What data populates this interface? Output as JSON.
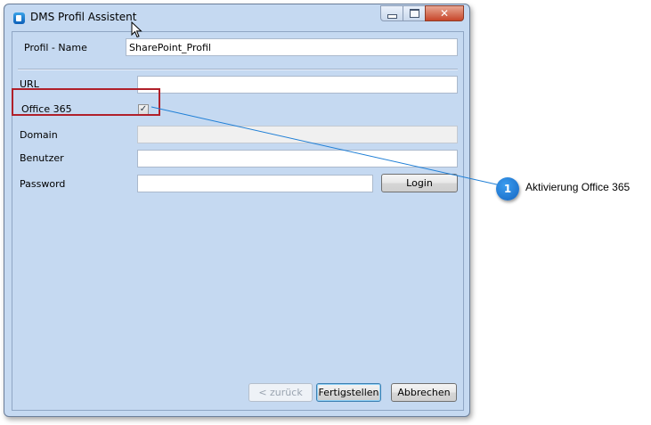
{
  "window": {
    "title": "DMS Profil Assistent",
    "accent_color": "#c5d9f1",
    "close_glyph": "✕"
  },
  "form": {
    "profile_name_label": "Profil - Name",
    "profile_name_value": "SharePoint_Profil",
    "url_label": "URL",
    "url_value": "",
    "office365_label": "Office 365",
    "office365_checked": true,
    "office365_tick": "✓",
    "domain_label": "Domain",
    "domain_value": "",
    "user_label": "Benutzer",
    "user_value": "",
    "password_label": "Password",
    "password_value": "",
    "login_label": "Login"
  },
  "footer": {
    "back_label": "< zurück",
    "finish_label": "Fertigstellen",
    "cancel_label": "Abbrechen"
  },
  "callout": {
    "number": "1",
    "text": "Aktivierung Office 365",
    "highlight_color": "#b0202a",
    "line_color": "#1f7fd6"
  }
}
